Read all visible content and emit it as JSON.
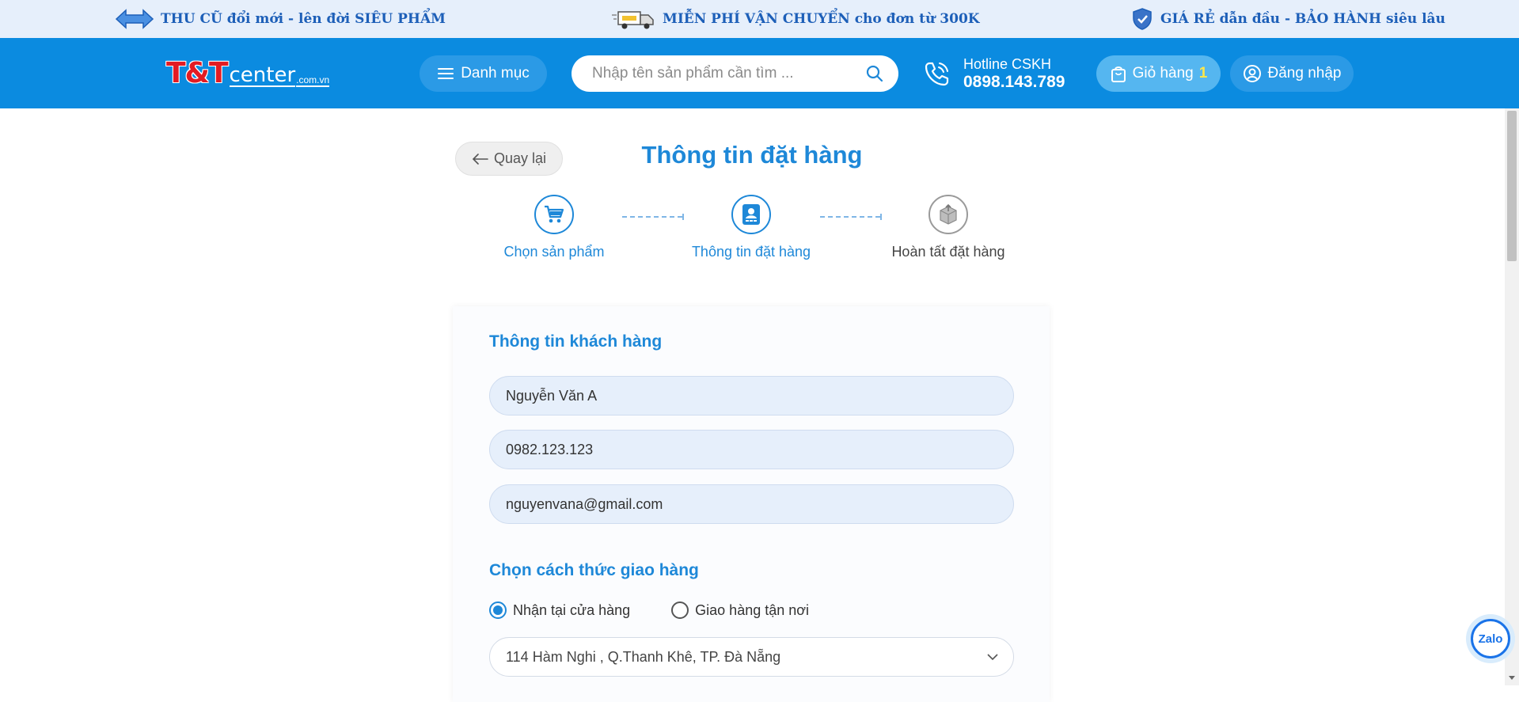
{
  "promo_bar": {
    "item1": "THU CŨ đổi mới - lên đời SIÊU PHẨM",
    "item2": "MIỄN PHÍ VẬN CHUYỂN cho đơn từ 300K",
    "item3": "GIÁ RẺ dẫn đầu -  BẢO HÀNH siêu lâu"
  },
  "header": {
    "logo_main": "T&T",
    "logo_center": "center",
    "logo_domain": ".com.vn",
    "menu_label": "Danh mục",
    "search_placeholder": "Nhập tên sản phẩm cần tìm ...",
    "hotline_label": "Hotline CSKH",
    "hotline_number": "0898.143.789",
    "cart_label": "Giỏ hàng",
    "cart_count": "1",
    "login_label": "Đăng nhập"
  },
  "page": {
    "back_label": "Quay lại",
    "title": "Thông tin đặt hàng"
  },
  "steps": [
    {
      "label": "Chọn sản phẩm",
      "icon": "cart-icon",
      "state": "done"
    },
    {
      "label": "Thông tin đặt hàng",
      "icon": "id-card-icon",
      "state": "current"
    },
    {
      "label": "Hoàn tất đặt hàng",
      "icon": "box-icon",
      "state": "pending"
    }
  ],
  "customer": {
    "section_title": "Thông tin khách hàng",
    "name": "Nguyễn Văn A",
    "phone": "0982.123.123",
    "email": "nguyenvana@gmail.com"
  },
  "shipping": {
    "section_title": "Chọn cách thức giao hàng",
    "option_pickup": "Nhận tại cửa hàng",
    "option_delivery": "Giao hàng tận nơi",
    "selected": "pickup",
    "store_address": "114 Hàm Nghi , Q.Thanh Khê, TP. Đà Nẵng"
  },
  "chat": {
    "zalo_label": "Zalo"
  },
  "colors": {
    "primary": "#0b8be0",
    "accent": "#1e88d8",
    "promo_text": "#1d5fb8",
    "logo_red": "#e31b23"
  }
}
